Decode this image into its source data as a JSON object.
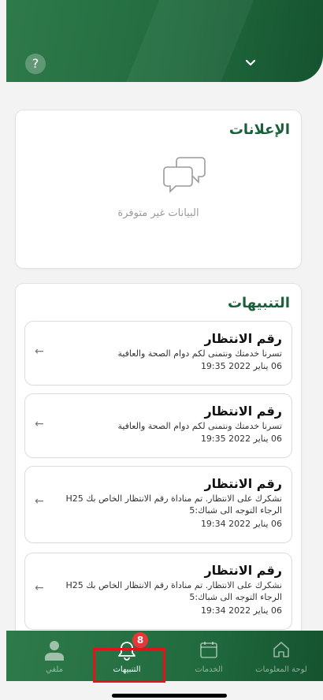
{
  "header": {
    "help_symbol": "?",
    "dropdown_icon": "chevron-down-icon"
  },
  "announcements": {
    "title": "الإعلانات",
    "empty_text": "البيانات غير متوفرة",
    "empty_icon": "chat-bubbles-icon"
  },
  "notifications": {
    "title": "التنبيهات",
    "items": [
      {
        "title": "رقم الانتظار",
        "body": "تسرنا خدمتك ونتمنى لكم دوام الصحة والعافية",
        "date": "06 يناير 2022 19:35"
      },
      {
        "title": "رقم الانتظار",
        "body": "تسرنا خدمتك ونتمنى لكم دوام الصحة والعافية",
        "date": "06 يناير 2022 19:35"
      },
      {
        "title": "رقم الانتظار",
        "body": "نشكرك على الانتظار. تم مناداة رقم الانتظار الخاص بك H25 الرجاء التوجه الى شباك:5",
        "date": "06 يناير 2022 19:34"
      },
      {
        "title": "رقم الانتظار",
        "body": "نشكرك على الانتظار. تم مناداة رقم الانتظار الخاص بك H25 الرجاء التوجه الى شباك:5",
        "date": "06 يناير 2022 19:34"
      }
    ]
  },
  "bottom_nav": {
    "items": [
      {
        "label": "ملفي",
        "icon": "profile-icon"
      },
      {
        "label": "التنبيهات",
        "icon": "bell-icon",
        "badge": "8",
        "active": true
      },
      {
        "label": "الخدمات",
        "icon": "calendar-icon"
      },
      {
        "label": "لوحة المعلومات",
        "icon": "home-icon"
      }
    ]
  },
  "colors": {
    "brand_green": "#216b3f",
    "title_green": "#1a5e3a",
    "badge_red": "#e53939",
    "highlight_red": "#e2141a"
  }
}
